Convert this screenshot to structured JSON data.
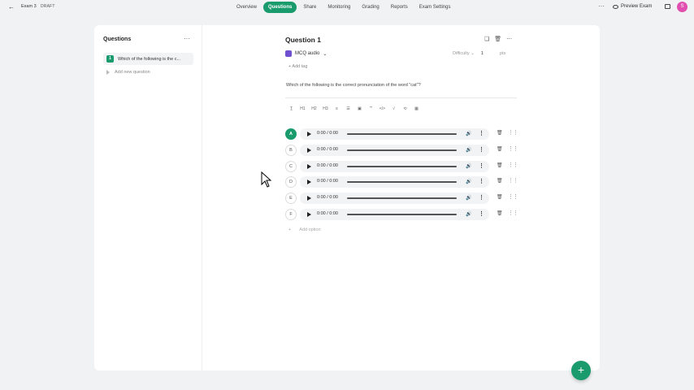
{
  "topbar": {
    "back_icon": "arrow-left-icon",
    "exam_title": "Exam 3",
    "status": "DRAFT",
    "tabs": [
      "Overview",
      "Questions",
      "Share",
      "Monitoring",
      "Grading",
      "Reports",
      "Exam Settings"
    ],
    "active_tab": "Questions",
    "more_label": "···",
    "preview_label": "Preview Exam",
    "avatar_initial": "S",
    "accent_color": "#1a9b6e"
  },
  "sidebar": {
    "title": "Questions",
    "more_label": "···",
    "items": [
      {
        "number": "1",
        "label": "Which of the following is the c..."
      }
    ],
    "add_label": "Add new question"
  },
  "question": {
    "title": "Question 1",
    "type": "MCQ audio",
    "difficulty_label": "Difficulty",
    "points_value": "1",
    "points_unit": "pts",
    "add_tag": "+ Add tag",
    "prompt": "Which of the following is the correct pronunciation of the word \"cat\"?",
    "toolbar": [
      "T̲",
      "H1",
      "H2",
      "H3",
      "≡",
      "☰",
      "▣",
      "“”",
      "</>",
      "√",
      "⟲",
      "▦"
    ],
    "options": [
      {
        "letter": "A",
        "time": "0:00 / 0:00",
        "correct": true
      },
      {
        "letter": "B",
        "time": "0:00 / 0:00",
        "correct": false
      },
      {
        "letter": "C",
        "time": "0:00 / 0:00",
        "correct": false
      },
      {
        "letter": "D",
        "time": "0:00 / 0:00",
        "correct": false
      },
      {
        "letter": "E",
        "time": "0:00 / 0:00",
        "correct": false
      },
      {
        "letter": "F",
        "time": "0:00 / 0:00",
        "correct": false
      }
    ],
    "add_option": "Add option",
    "add_option_icon": "+"
  },
  "fab_label": "+"
}
